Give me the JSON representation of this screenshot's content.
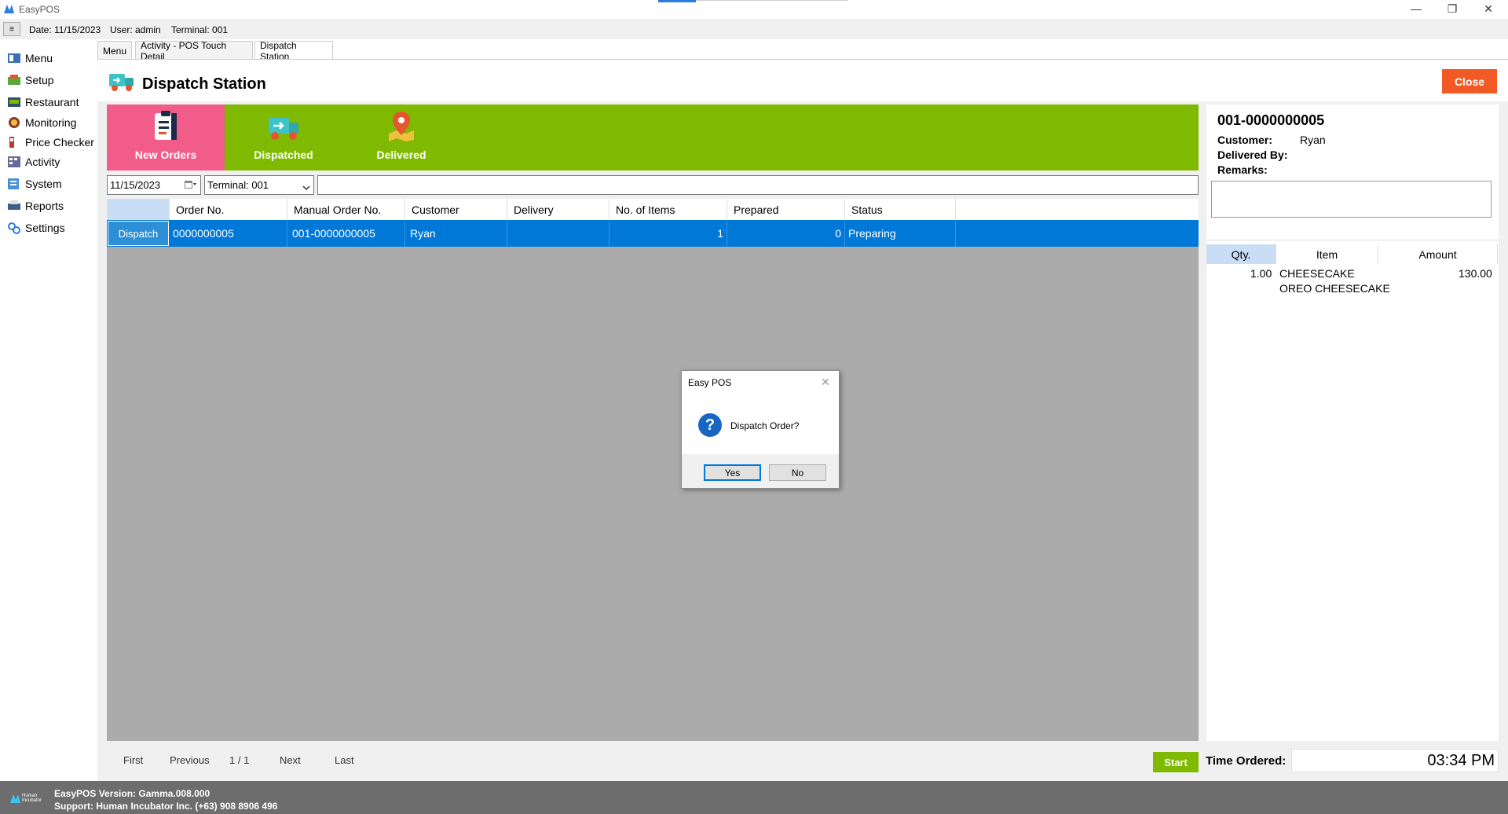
{
  "window": {
    "title": "EasyPOS",
    "controls": [
      "—",
      "❐",
      "✕"
    ]
  },
  "statusbar": {
    "menu_glyph": "≡",
    "date": "Date: 11/15/2023",
    "user": "User: admin",
    "terminal": "Terminal: 001"
  },
  "sidebar": {
    "items": [
      {
        "label": "Menu",
        "icon": "menu-icon"
      },
      {
        "label": "Setup",
        "icon": "setup-icon"
      },
      {
        "label": "Restaurant",
        "icon": "restaurant-icon"
      },
      {
        "label": "Monitoring",
        "icon": "monitoring-icon"
      },
      {
        "label": "Price Checker",
        "icon": "price-checker-icon"
      },
      {
        "label": "Activity",
        "icon": "activity-icon"
      },
      {
        "label": "System",
        "icon": "system-icon"
      },
      {
        "label": "Reports",
        "icon": "reports-icon"
      },
      {
        "label": "Settings",
        "icon": "settings-icon"
      }
    ]
  },
  "tabs": [
    "Menu",
    "Activity - POS Touch Detail",
    "Dispatch Station"
  ],
  "page": {
    "title": "Dispatch Station",
    "close_label": "Close"
  },
  "status_tabs": [
    "New Orders",
    "Dispatched",
    "Delivered"
  ],
  "filters": {
    "date": "11/15/2023",
    "terminal": "Terminal: 001",
    "search": ""
  },
  "grid": {
    "columns": [
      "",
      "Order No.",
      "Manual Order No.",
      "Customer",
      "Delivery",
      "No. of Items",
      "Prepared",
      "Status"
    ],
    "rows": [
      {
        "action": "Dispatch",
        "order_no": "0000000005",
        "manual_order_no": "001-0000000005",
        "customer": "Ryan",
        "delivery": "",
        "items": "1",
        "prepared": "0",
        "status": "Preparing"
      }
    ]
  },
  "detail": {
    "order_no": "001-0000000005",
    "customer_label": "Customer:",
    "customer": "Ryan",
    "delivered_by_label": "Delivered By:",
    "remarks_label": "Remarks:",
    "item_columns": [
      "Qty.",
      "Item",
      "Amount"
    ],
    "items": [
      {
        "qty": "1.00",
        "item": "CHEESECAKE",
        "sub": "OREO CHEESECAKE",
        "amount": "130.00"
      }
    ]
  },
  "pager": {
    "first": "First",
    "previous": "Previous",
    "page": "1 / 1",
    "next": "Next",
    "last": "Last"
  },
  "timer": {
    "start_label": "Start",
    "time_label": "Time Ordered:",
    "time_value": "03:34 PM"
  },
  "footer": {
    "version": "EasyPOS Version: Gamma.008.000",
    "support": "Support: Human Incubator Inc. (+63) 908 8906 496",
    "logo_text": "Human Incubator"
  },
  "dialog": {
    "title": "Easy POS",
    "close_glyph": "✕",
    "message": "Dispatch Order?",
    "yes": "Yes",
    "no": "No"
  },
  "colors": {
    "accent_green": "#7fba00",
    "active_tab_pink": "#f25c8a",
    "selection_blue": "#0078d7",
    "close_orange": "#f15a24"
  }
}
